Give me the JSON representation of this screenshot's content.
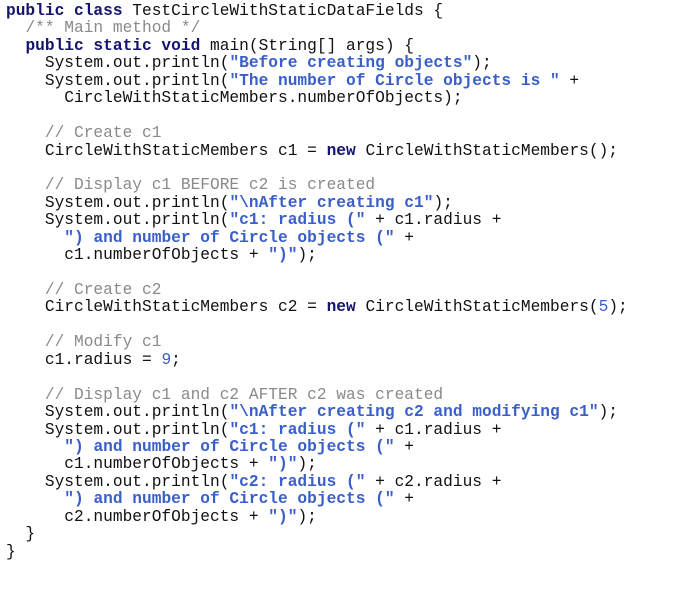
{
  "document": {
    "language": "java",
    "lines": [
      [
        {
          "t": "kw",
          "v": "public class"
        },
        {
          "t": "pl",
          "v": " TestCircleWithStaticDataFields {"
        }
      ],
      [
        {
          "t": "pl",
          "v": "  "
        },
        {
          "t": "cm",
          "v": "/** Main method */"
        }
      ],
      [
        {
          "t": "pl",
          "v": "  "
        },
        {
          "t": "kw",
          "v": "public static void"
        },
        {
          "t": "pl",
          "v": " main(String[] args) {"
        }
      ],
      [
        {
          "t": "pl",
          "v": "    System.out.println("
        },
        {
          "t": "str",
          "v": "\"Before creating objects\""
        },
        {
          "t": "pl",
          "v": ");"
        }
      ],
      [
        {
          "t": "pl",
          "v": "    System.out.println("
        },
        {
          "t": "str",
          "v": "\"The number of Circle objects is \""
        },
        {
          "t": "pl",
          "v": " +"
        }
      ],
      [
        {
          "t": "pl",
          "v": "      CircleWithStaticMembers.numberOfObjects);"
        }
      ],
      [],
      [
        {
          "t": "pl",
          "v": "    "
        },
        {
          "t": "cm",
          "v": "// Create c1"
        }
      ],
      [
        {
          "t": "pl",
          "v": "    CircleWithStaticMembers c1 = "
        },
        {
          "t": "kw",
          "v": "new"
        },
        {
          "t": "pl",
          "v": " CircleWithStaticMembers();"
        }
      ],
      [],
      [
        {
          "t": "pl",
          "v": "    "
        },
        {
          "t": "cm",
          "v": "// Display c1 BEFORE c2 is created"
        }
      ],
      [
        {
          "t": "pl",
          "v": "    System.out.println("
        },
        {
          "t": "str",
          "v": "\"\\nAfter creating c1\""
        },
        {
          "t": "pl",
          "v": ");"
        }
      ],
      [
        {
          "t": "pl",
          "v": "    System.out.println("
        },
        {
          "t": "str",
          "v": "\"c1: radius (\""
        },
        {
          "t": "pl",
          "v": " + c1.radius +"
        }
      ],
      [
        {
          "t": "pl",
          "v": "      "
        },
        {
          "t": "str",
          "v": "\") and number of Circle objects (\""
        },
        {
          "t": "pl",
          "v": " +"
        }
      ],
      [
        {
          "t": "pl",
          "v": "      c1.numberOfObjects + "
        },
        {
          "t": "str",
          "v": "\")\""
        },
        {
          "t": "pl",
          "v": ");"
        }
      ],
      [],
      [
        {
          "t": "pl",
          "v": "    "
        },
        {
          "t": "cm",
          "v": "// Create c2"
        }
      ],
      [
        {
          "t": "pl",
          "v": "    CircleWithStaticMembers c2 = "
        },
        {
          "t": "kw",
          "v": "new"
        },
        {
          "t": "pl",
          "v": " CircleWithStaticMembers("
        },
        {
          "t": "num",
          "v": "5"
        },
        {
          "t": "pl",
          "v": ");"
        }
      ],
      [],
      [
        {
          "t": "pl",
          "v": "    "
        },
        {
          "t": "cm",
          "v": "// Modify c1"
        }
      ],
      [
        {
          "t": "pl",
          "v": "    c1.radius = "
        },
        {
          "t": "num",
          "v": "9"
        },
        {
          "t": "pl",
          "v": ";"
        }
      ],
      [],
      [
        {
          "t": "pl",
          "v": "    "
        },
        {
          "t": "cm",
          "v": "// Display c1 and c2 AFTER c2 was created"
        }
      ],
      [
        {
          "t": "pl",
          "v": "    System.out.println("
        },
        {
          "t": "str",
          "v": "\"\\nAfter creating c2 and modifying c1\""
        },
        {
          "t": "pl",
          "v": ");"
        }
      ],
      [
        {
          "t": "pl",
          "v": "    System.out.println("
        },
        {
          "t": "str",
          "v": "\"c1: radius (\""
        },
        {
          "t": "pl",
          "v": " + c1.radius +"
        }
      ],
      [
        {
          "t": "pl",
          "v": "      "
        },
        {
          "t": "str",
          "v": "\") and number of Circle objects (\""
        },
        {
          "t": "pl",
          "v": " +"
        }
      ],
      [
        {
          "t": "pl",
          "v": "      c1.numberOfObjects + "
        },
        {
          "t": "str",
          "v": "\")\""
        },
        {
          "t": "pl",
          "v": ");"
        }
      ],
      [
        {
          "t": "pl",
          "v": "    System.out.println("
        },
        {
          "t": "str",
          "v": "\"c2: radius (\""
        },
        {
          "t": "pl",
          "v": " + c2.radius +"
        }
      ],
      [
        {
          "t": "pl",
          "v": "      "
        },
        {
          "t": "str",
          "v": "\") and number of Circle objects (\""
        },
        {
          "t": "pl",
          "v": " +"
        }
      ],
      [
        {
          "t": "pl",
          "v": "      c2.numberOfObjects + "
        },
        {
          "t": "str",
          "v": "\")\""
        },
        {
          "t": "pl",
          "v": ");"
        }
      ],
      [
        {
          "t": "pl",
          "v": "  }"
        }
      ],
      [
        {
          "t": "pl",
          "v": "}"
        }
      ]
    ]
  },
  "colors": {
    "keyword": "#14146e",
    "string": "#3a5fc8",
    "comment": "#8a8a8a",
    "number": "#3a5fc8",
    "text": "#111111",
    "background": "#ffffff"
  }
}
